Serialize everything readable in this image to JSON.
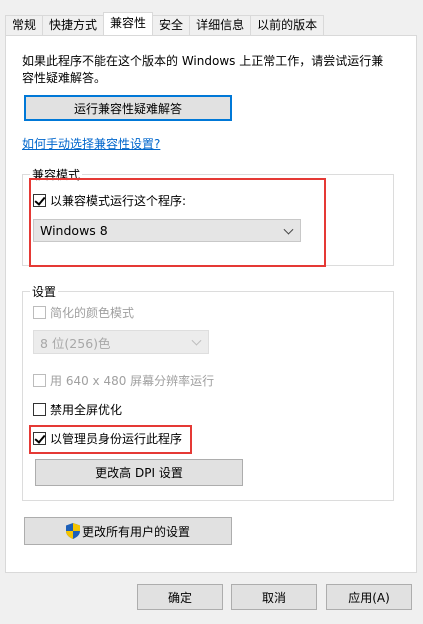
{
  "tabs": [
    "常规",
    "快捷方式",
    "兼容性",
    "安全",
    "详细信息",
    "以前的版本"
  ],
  "intro_text": "如果此程序不能在这个版本的 Windows 上正常工作，请尝试运行兼容性疑难解答。",
  "troubleshoot_button": "运行兼容性疑难解答",
  "manual_link": "如何手动选择兼容性设置?",
  "compat_group": {
    "title": "兼容模式",
    "checkbox_label": "以兼容模式运行这个程序:",
    "checked": true,
    "selected_os": "Windows 8"
  },
  "settings_group": {
    "title": "设置",
    "reduced_color_label": "简化的颜色模式",
    "color_select": "8 位(256)色",
    "res_640_label": "用 640 x 480 屏幕分辨率运行",
    "disable_fullscreen_label": "禁用全屏优化",
    "run_as_admin_label": "以管理员身份运行此程序",
    "run_as_admin_checked": true,
    "dpi_button": "更改高 DPI 设置"
  },
  "all_users_button": "更改所有用户的设置",
  "footer": {
    "ok": "确定",
    "cancel": "取消",
    "apply": "应用(A)"
  },
  "colors": {
    "highlight": "#e53935",
    "link": "#0066cc",
    "focus": "#0078d7"
  }
}
